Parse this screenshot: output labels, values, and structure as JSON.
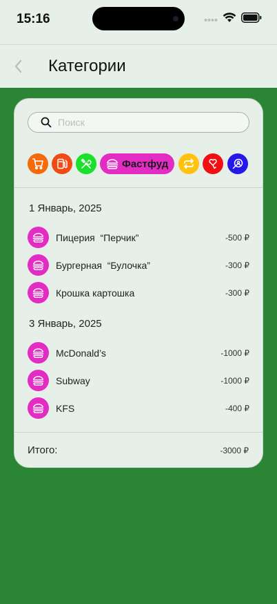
{
  "status_bar": {
    "time": "15:16"
  },
  "nav": {
    "title": "Категории"
  },
  "search": {
    "placeholder": "Поиск"
  },
  "categories": {
    "icons": [
      {
        "name": "cart-icon",
        "color": "#f56a0a"
      },
      {
        "name": "fuel-icon",
        "color": "#f24a14"
      },
      {
        "name": "tools-icon",
        "color": "#19e02a"
      },
      {
        "name": "transfer-icon",
        "color": "#ffc20f"
      },
      {
        "name": "heart-hand-icon",
        "color": "#f20f14"
      },
      {
        "name": "search-person-icon",
        "color": "#2618e8"
      }
    ],
    "selected": {
      "label": "Фастфуд",
      "icon": "burger-icon",
      "color": "#e22cc4"
    }
  },
  "groups": [
    {
      "date": "1 Январь, 2025",
      "items": [
        {
          "name": "Пицерия  “Перчик”",
          "amount": "-500 ₽"
        },
        {
          "name": "Бургерная  “Булочка”",
          "amount": "-300 ₽"
        },
        {
          "name": "Крошка картошка",
          "amount": "-300 ₽"
        }
      ]
    },
    {
      "date": "3 Январь, 2025",
      "items": [
        {
          "name": "McDonald’s",
          "amount": "-1000 ₽"
        },
        {
          "name": "Subway",
          "amount": "-1000 ₽"
        },
        {
          "name": "KFS",
          "amount": "-400 ₽"
        }
      ]
    }
  ],
  "total": {
    "label": "Итого:",
    "amount": "-3000 ₽"
  },
  "colors": {
    "background": "#2a8535",
    "surface": "#e6efe8",
    "accent": "#e22cc4"
  }
}
